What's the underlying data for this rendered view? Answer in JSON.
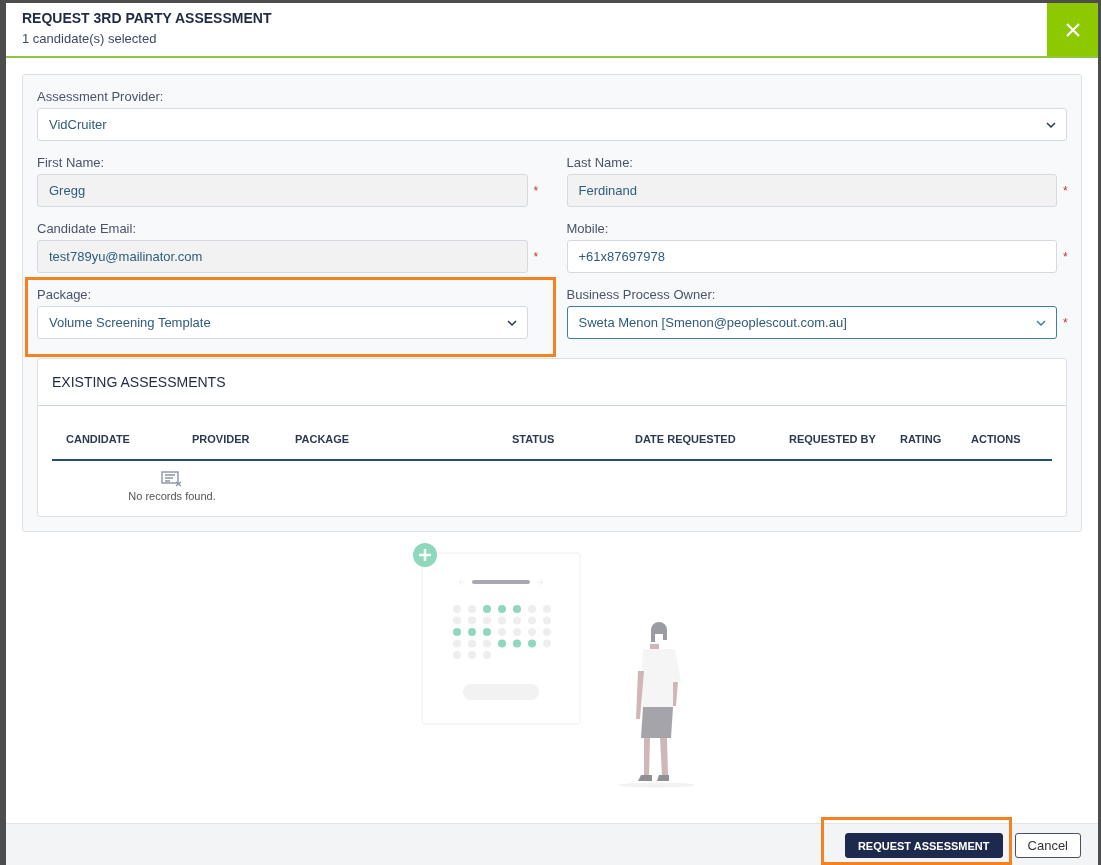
{
  "dialog": {
    "title": "REQUEST 3RD PARTY ASSESSMENT",
    "subtitle": "1 candidate(s) selected"
  },
  "provider": {
    "label": "Assessment Provider:",
    "value": "VidCruiter"
  },
  "fields": [
    {
      "label": "First Name:",
      "value": "Gregg",
      "kind": "text",
      "readonly": true,
      "required_mark": "*",
      "highlighted": false,
      "focused": false
    },
    {
      "label": "Last Name:",
      "value": "Ferdinand",
      "kind": "text",
      "readonly": true,
      "required_mark": "*",
      "highlighted": false,
      "focused": false
    },
    {
      "label": "Candidate Email:",
      "value": "test789yu@mailinator.com",
      "kind": "text",
      "readonly": true,
      "required_mark": "*",
      "highlighted": false,
      "focused": false
    },
    {
      "label": "Mobile:",
      "value": "+61x87697978",
      "kind": "text",
      "readonly": false,
      "required_mark": "*",
      "highlighted": false,
      "focused": false
    },
    {
      "label": "Package:",
      "value": "Volume Screening Template",
      "kind": "select",
      "readonly": false,
      "highlighted": true,
      "focused": false
    },
    {
      "label": "Business Process Owner:",
      "value": "Sweta Menon [Smenon@peoplescout.com.au]",
      "kind": "select",
      "readonly": false,
      "required_mark": "*",
      "highlighted": false,
      "focused": true
    }
  ],
  "assessments": {
    "title": "EXISTING ASSESSMENTS",
    "columns": [
      "CANDIDATE",
      "PROVIDER",
      "PACKAGE",
      "STATUS",
      "DATE REQUESTED",
      "REQUESTED BY",
      "RATING",
      "ACTIONS"
    ],
    "empty_message": "No records found."
  },
  "buttons": [
    {
      "label": "REQUEST ASSESSMENT",
      "kind": "primary",
      "highlighted": true
    },
    {
      "label": "Cancel",
      "kind": "secondary",
      "highlighted": false
    }
  ]
}
